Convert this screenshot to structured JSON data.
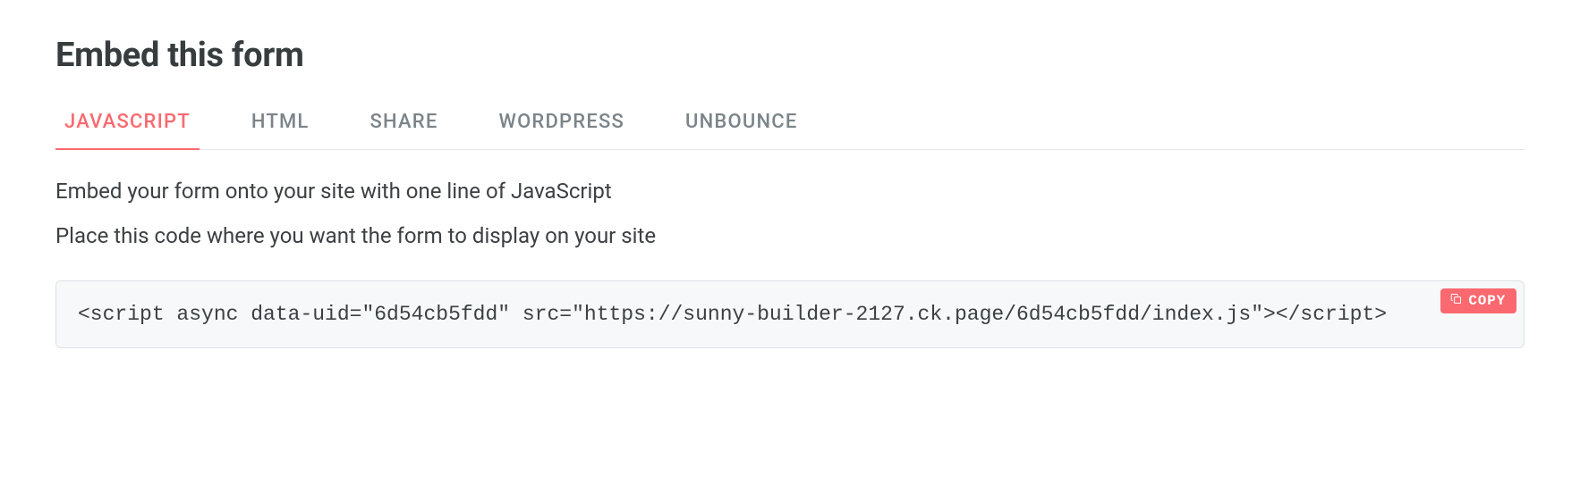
{
  "title": "Embed this form",
  "tabs": [
    {
      "label": "JAVASCRIPT",
      "active": true
    },
    {
      "label": "HTML",
      "active": false
    },
    {
      "label": "SHARE",
      "active": false
    },
    {
      "label": "WORDPRESS",
      "active": false
    },
    {
      "label": "UNBOUNCE",
      "active": false
    }
  ],
  "description": "Embed your form onto your site with one line of JavaScript",
  "instruction": "Place this code where you want the form to display on your site",
  "code_snippet": "<script async data-uid=\"6d54cb5fdd\" src=\"https://sunny-builder-2127.ck.page/6d54cb5fdd/index.js\"></script>",
  "copy_button_label": "COPY"
}
